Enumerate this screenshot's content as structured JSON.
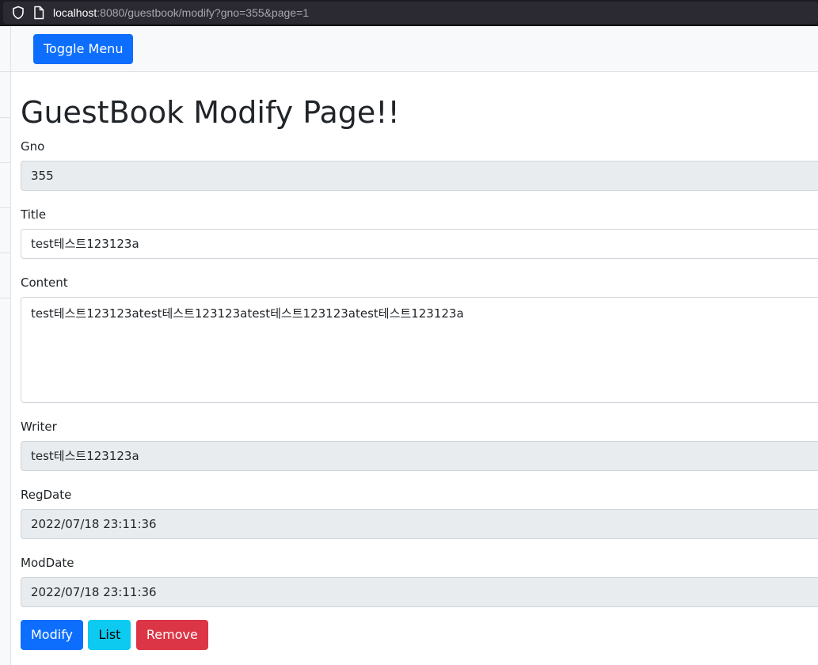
{
  "browser": {
    "url_host": "localhost",
    "url_rest": ":8080/guestbook/modify?gno=355&page=1"
  },
  "navbar": {
    "toggle_label": "Toggle Menu"
  },
  "page": {
    "title": "GuestBook Modify Page!!"
  },
  "form": {
    "gno_label": "Gno",
    "gno_value": "355",
    "title_label": "Title",
    "title_value": "test테스트123123a",
    "content_label": "Content",
    "content_value": "test테스트123123atest테스트123123atest테스트123123atest테스트123123a",
    "writer_label": "Writer",
    "writer_value": "test테스트123123a",
    "regdate_label": "RegDate",
    "regdate_value": "2022/07/18 23:11:36",
    "moddate_label": "ModDate",
    "moddate_value": "2022/07/18 23:11:36"
  },
  "actions": {
    "modify_label": "Modify",
    "list_label": "List",
    "remove_label": "Remove"
  },
  "colors": {
    "primary": "#0d6efd",
    "info": "#0dcaf0",
    "danger": "#dc3545",
    "readonly_bg": "#e9ecef"
  },
  "icons": {
    "security": "shield-icon",
    "page": "page-icon"
  }
}
